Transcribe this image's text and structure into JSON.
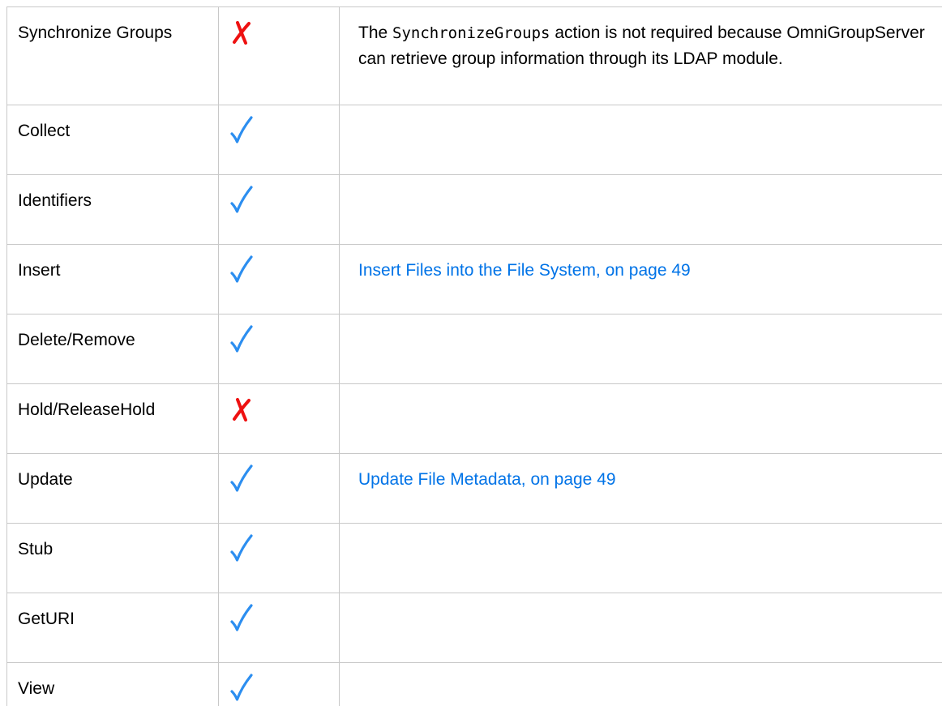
{
  "colors": {
    "check": "#2c8ef0",
    "cross": "#ee1111",
    "link": "#0073e7",
    "border": "#c8c8c8"
  },
  "rows": [
    {
      "action": "Synchronize Groups",
      "supported": false,
      "support_icon": "cross-icon",
      "note_prefix": "The ",
      "note_code": "SynchronizeGroups",
      "note_suffix": " action is not required because OmniGroupServer can retrieve group information through its LDAP module."
    },
    {
      "action": "Collect",
      "supported": true,
      "support_icon": "check-icon"
    },
    {
      "action": "Identifiers",
      "supported": true,
      "support_icon": "check-icon"
    },
    {
      "action": "Insert",
      "supported": true,
      "support_icon": "check-icon",
      "note_link": "Insert Files into the File System, on page 49"
    },
    {
      "action": "Delete/Remove",
      "supported": true,
      "support_icon": "check-icon"
    },
    {
      "action": "Hold/ReleaseHold",
      "supported": false,
      "support_icon": "cross-icon"
    },
    {
      "action": "Update",
      "supported": true,
      "support_icon": "check-icon",
      "note_link": "Update File Metadata, on page 49"
    },
    {
      "action": "Stub",
      "supported": true,
      "support_icon": "check-icon"
    },
    {
      "action": "GetURI",
      "supported": true,
      "support_icon": "check-icon"
    },
    {
      "action": "View",
      "supported": true,
      "support_icon": "check-icon"
    }
  ]
}
